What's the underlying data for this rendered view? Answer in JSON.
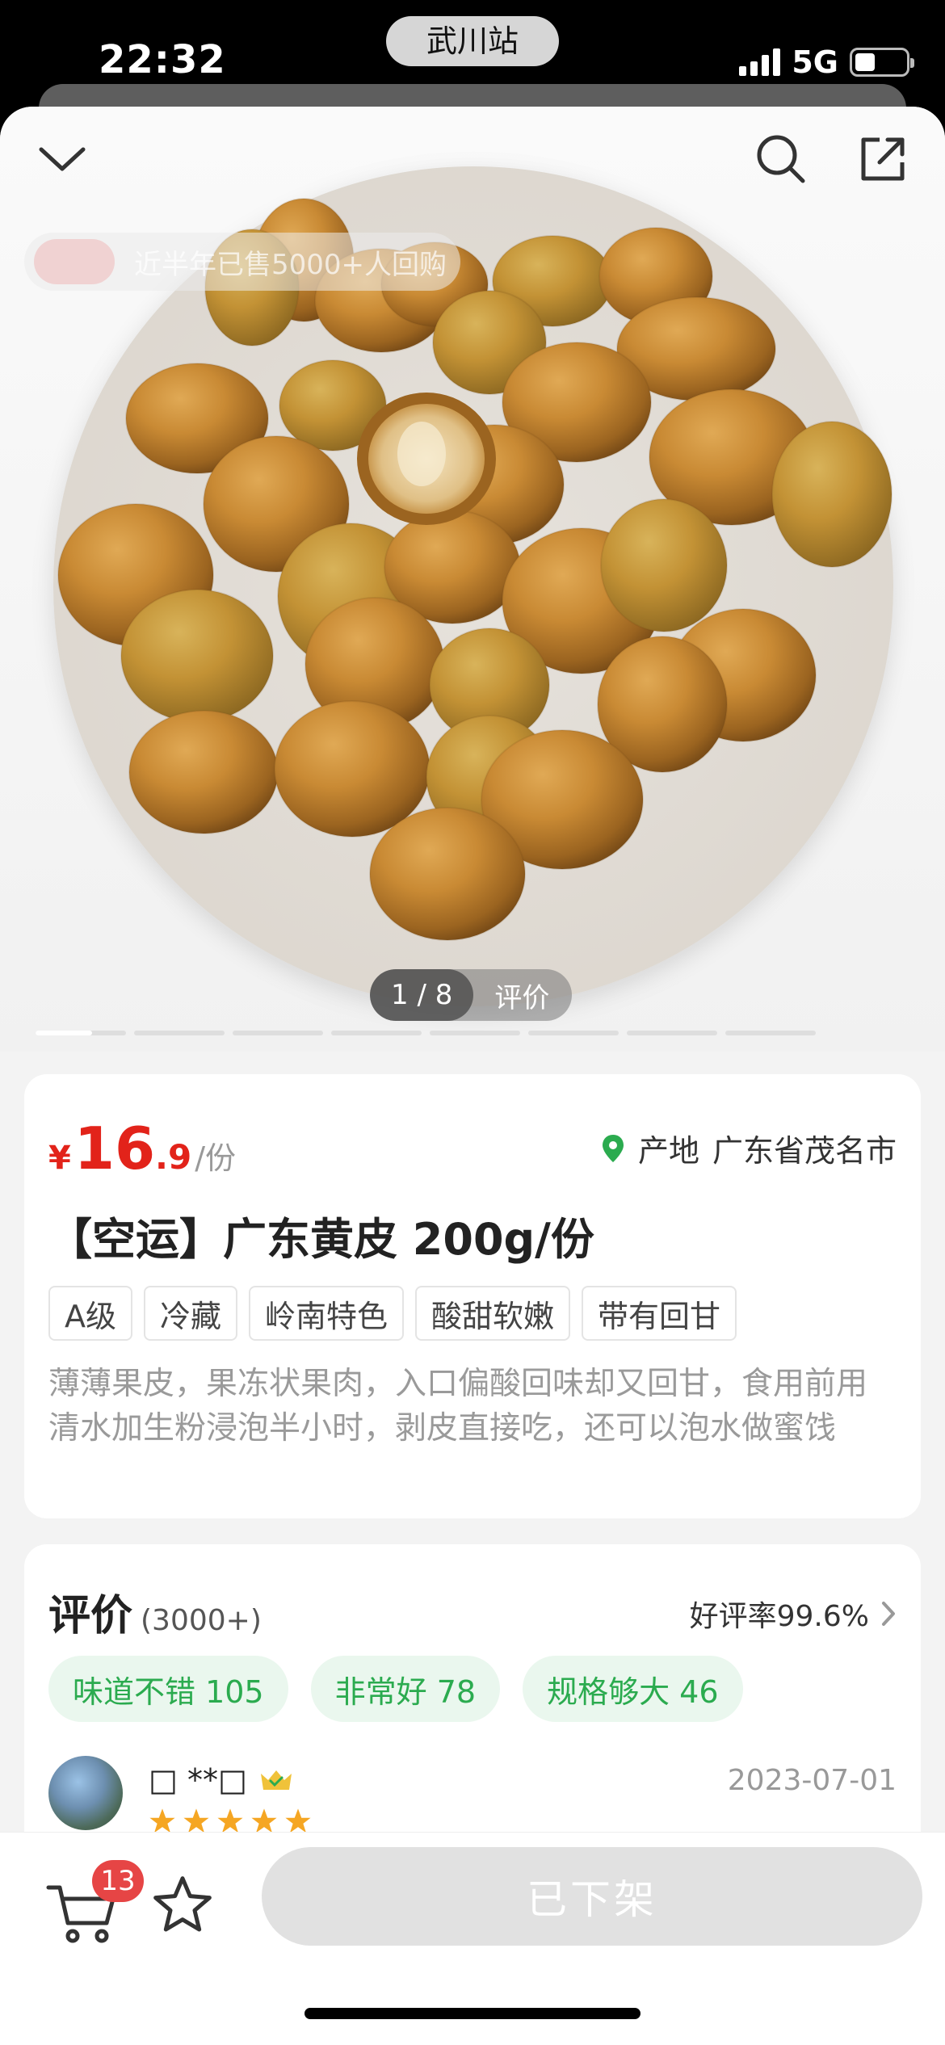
{
  "status": {
    "time": "22:32",
    "location": "武川站",
    "network": "5G"
  },
  "hero": {
    "sold_badge": "近半年已售5000+人回购",
    "counter_current": "1 / 8",
    "counter_reviews": "评价",
    "total_images": 8,
    "current_image": 1
  },
  "product": {
    "currency": "¥",
    "price_int": "16",
    "price_dec": ".9",
    "price_unit": "/份",
    "origin_label": "产地",
    "origin_value": "广东省茂名市",
    "title": "【空运】广东黄皮 200g/份",
    "tags": [
      "A级",
      "冷藏",
      "岭南特色",
      "酸甜软嫩",
      "带有回甘"
    ],
    "description": "薄薄果皮，果冻状果肉，入口偏酸回味却又回甘，食用前用清水加生粉浸泡半小时，剥皮直接吃，还可以泡水做蜜饯"
  },
  "reviews": {
    "title": "评价",
    "count": "(3000+)",
    "good_rate": "好评率99.6%",
    "tags": [
      "味道不错 105",
      "非常好 78",
      "规格够大 46"
    ],
    "first": {
      "name": "□ **□",
      "date": "2023-07-01",
      "stars": 5
    }
  },
  "bottom": {
    "cart_count": "13",
    "offshelf_label": "已下架"
  },
  "colors": {
    "price_red": "#e2231a",
    "tag_green": "#2bab4f",
    "tag_green_bg": "#eaf7ee",
    "star_orange": "#f5a623"
  },
  "icons": [
    "chevron-down-icon",
    "search-icon",
    "share-icon",
    "location-pin-icon",
    "chevron-right-icon",
    "crown-icon",
    "star-icon",
    "cart-icon",
    "favorite-star-icon"
  ]
}
